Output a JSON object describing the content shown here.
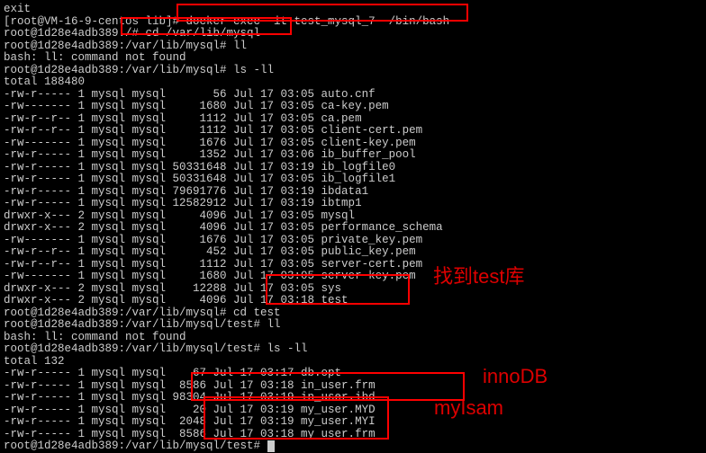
{
  "lines": {
    "l0": "exit",
    "l1": "[root@VM-16-9-centos lib]# docker exec -it test_mysql_7  /bin/bash",
    "l2": "root@1d28e4adb389:/# cd /var/lib/mysql",
    "l3": "root@1d28e4adb389:/var/lib/mysql# ll",
    "l4": "bash: ll: command not found",
    "l5": "root@1d28e4adb389:/var/lib/mysql# ls -ll",
    "l6": "total 188480",
    "l7": "-rw-r----- 1 mysql mysql       56 Jul 17 03:05 auto.cnf",
    "l8": "-rw------- 1 mysql mysql     1680 Jul 17 03:05 ca-key.pem",
    "l9": "-rw-r--r-- 1 mysql mysql     1112 Jul 17 03:05 ca.pem",
    "l10": "-rw-r--r-- 1 mysql mysql     1112 Jul 17 03:05 client-cert.pem",
    "l11": "-rw------- 1 mysql mysql     1676 Jul 17 03:05 client-key.pem",
    "l12": "-rw-r----- 1 mysql mysql     1352 Jul 17 03:06 ib_buffer_pool",
    "l13": "-rw-r----- 1 mysql mysql 50331648 Jul 17 03:19 ib_logfile0",
    "l14": "-rw-r----- 1 mysql mysql 50331648 Jul 17 03:05 ib_logfile1",
    "l15": "-rw-r----- 1 mysql mysql 79691776 Jul 17 03:19 ibdata1",
    "l16": "-rw-r----- 1 mysql mysql 12582912 Jul 17 03:19 ibtmp1",
    "l17": "drwxr-x--- 2 mysql mysql     4096 Jul 17 03:05 mysql",
    "l18": "drwxr-x--- 2 mysql mysql     4096 Jul 17 03:05 performance_schema",
    "l19": "-rw------- 1 mysql mysql     1676 Jul 17 03:05 private_key.pem",
    "l20": "-rw-r--r-- 1 mysql mysql      452 Jul 17 03:05 public_key.pem",
    "l21": "-rw-r--r-- 1 mysql mysql     1112 Jul 17 03:05 server-cert.pem",
    "l22": "-rw------- 1 mysql mysql     1680 Jul 17 03:05 server-key.pem",
    "l23": "drwxr-x--- 2 mysql mysql    12288 Jul 17 03:05 sys",
    "l24": "drwxr-x--- 2 mysql mysql     4096 Jul 17 03:18 test",
    "l25": "root@1d28e4adb389:/var/lib/mysql# cd test",
    "l26": "root@1d28e4adb389:/var/lib/mysql/test# ll",
    "l27": "bash: ll: command not found",
    "l28": "root@1d28e4adb389:/var/lib/mysql/test# ls -ll",
    "l29": "total 132",
    "l30": "-rw-r----- 1 mysql mysql    67 Jul 17 03:17 db.opt",
    "l31": "-rw-r----- 1 mysql mysql  8586 Jul 17 03:18 in_user.frm",
    "l32": "-rw-r----- 1 mysql mysql 98304 Jul 17 03:19 in_user.ibd",
    "l33": "-rw-r----- 1 mysql mysql    20 Jul 17 03:19 my_user.MYD",
    "l34": "-rw-r----- 1 mysql mysql  2048 Jul 17 03:19 my_user.MYI",
    "l35": "-rw-r----- 1 mysql mysql  8586 Jul 17 03:18 my_user.frm",
    "l36": "root@1d28e4adb389:/var/lib/mysql/test# "
  },
  "annotations": {
    "findtest": "找到test库",
    "innodb": "innoDB",
    "myisam": "myIsam"
  }
}
